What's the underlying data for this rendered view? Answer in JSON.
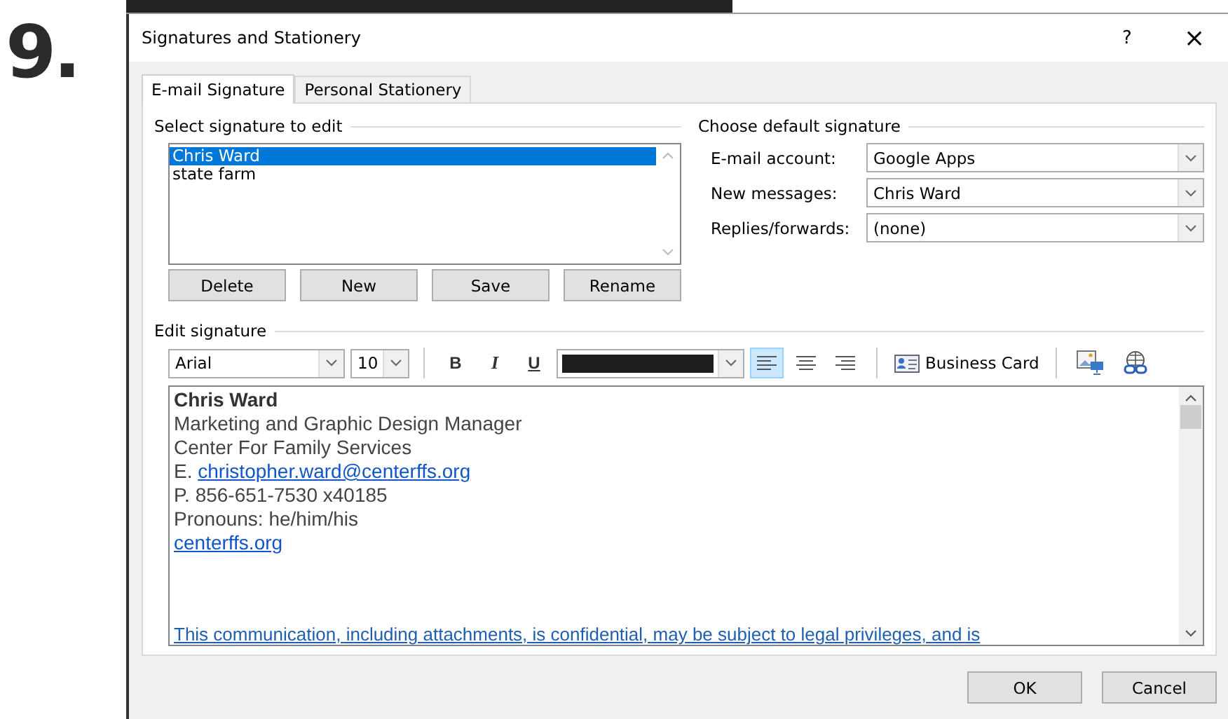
{
  "step_number": "9.",
  "window": {
    "title": "Signatures and Stationery",
    "help": "?",
    "close": "×"
  },
  "tabs": [
    {
      "label": "E-mail Signature",
      "selected": true
    },
    {
      "label": "Personal Stationery",
      "selected": false
    }
  ],
  "signature_list": {
    "label": "Select signature to edit",
    "items": [
      {
        "name": "Chris Ward",
        "selected": true
      },
      {
        "name": "state farm",
        "selected": false
      }
    ]
  },
  "signature_buttons": [
    "Delete",
    "New",
    "Save",
    "Rename"
  ],
  "default_signature": {
    "label": "Choose default signature",
    "fields": [
      {
        "label": "E-mail account:",
        "value": "Google Apps"
      },
      {
        "label": "New messages:",
        "value": "Chris Ward"
      },
      {
        "label": "Replies/forwards:",
        "value": "(none)"
      }
    ]
  },
  "edit_signature": {
    "label": "Edit signature",
    "font": "Arial",
    "size": "10",
    "format_buttons": [
      "B",
      "I",
      "U"
    ],
    "alignment": [
      {
        "kind": "left",
        "selected": true
      },
      {
        "kind": "center",
        "selected": false
      },
      {
        "kind": "right",
        "selected": false
      }
    ],
    "business_card": "Business Card",
    "lines": [
      {
        "kind": "bold",
        "text": "Chris Ward"
      },
      {
        "kind": "text",
        "text": "Marketing and Graphic Design Manager"
      },
      {
        "kind": "text",
        "text": "Center For Family Services"
      },
      {
        "kind": "labeled_link",
        "prefix": "E.",
        "text": "christopher.ward@centerffs.org"
      },
      {
        "kind": "text",
        "text": "P. 856-651-7530 x40185"
      },
      {
        "kind": "text",
        "text": "Pronouns: he/him/his"
      },
      {
        "kind": "link",
        "text": "centerffs.org"
      },
      {
        "kind": "gap"
      },
      {
        "kind": "notice",
        "text": "This communication, including attachments, is confidential, may be subject to legal privileges, and is"
      }
    ]
  },
  "buttons": [
    "OK",
    "Cancel"
  ]
}
